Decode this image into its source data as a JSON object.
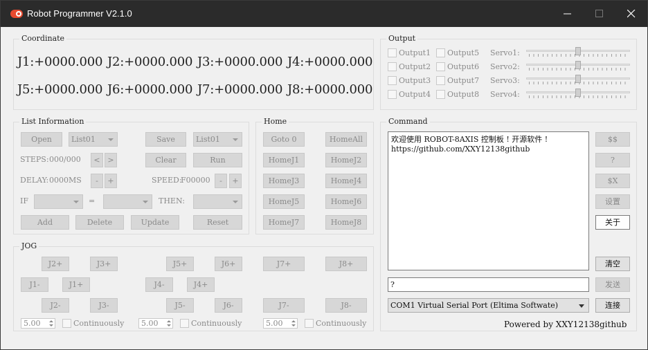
{
  "window": {
    "title": "Robot Programmer V2.1.0"
  },
  "coordinate": {
    "title": "Coordinate",
    "joints": [
      "J1:+0000.000",
      "J2:+0000.000",
      "J3:+0000.000",
      "J4:+0000.000",
      "J5:+0000.000",
      "J6:+0000.000",
      "J7:+0000.000",
      "J8:+0000.000"
    ]
  },
  "output": {
    "title": "Output",
    "checkboxes": [
      "Output1",
      "Output5",
      "Output2",
      "Output6",
      "Output3",
      "Output7",
      "Output4",
      "Output8"
    ],
    "servos": [
      {
        "label": "Servo1:",
        "level": 0.5
      },
      {
        "label": "Servo2:",
        "level": 0.5
      },
      {
        "label": "Servo3:",
        "level": 0.5
      },
      {
        "label": "Servo4:",
        "level": 0.5
      }
    ]
  },
  "list": {
    "title": "List Information",
    "open": "Open",
    "list_combo_1": "List01",
    "save": "Save",
    "list_combo_2": "List01",
    "steps_label": "STEPS:",
    "steps_value": "000/000",
    "prev": "<",
    "next": ">",
    "clear": "Clear",
    "run": "Run",
    "delay_label": "DELAY:",
    "delay_value": "0000MS",
    "minus": "-",
    "plus": "+",
    "speed_label": "SPEED:",
    "speed_value": "F00000",
    "if_label": "IF",
    "eq_label": "=",
    "then_label": "THEN:",
    "add": "Add",
    "delete": "Delete",
    "update": "Update",
    "reset": "Reset"
  },
  "home": {
    "title": "Home",
    "buttons": [
      "Goto 0",
      "HomeAll",
      "HomeJ1",
      "HomeJ2",
      "HomeJ3",
      "HomeJ4",
      "HomeJ5",
      "HomeJ6",
      "HomeJ7",
      "HomeJ8"
    ]
  },
  "command": {
    "title": "Command",
    "log": [
      "欢迎使用 ROBOT-8AXIS 控制板 ! 开源软件 !",
      "https://github.com/XXY12138github"
    ],
    "side_buttons": [
      "$$",
      "?",
      "$X",
      "设置",
      "关于"
    ],
    "clear": "清空",
    "input_value": "?",
    "send": "发送",
    "port": "COM1 Virtual Serial Port (Eltima Softwate)",
    "connect": "连接",
    "powered": "Powered by XXY12138github"
  },
  "jog": {
    "title": "JOG",
    "buttons": {
      "j2p": "J2+",
      "j3p": "J3+",
      "j5p": "J5+",
      "j6p": "J6+",
      "j7p": "J7+",
      "j8p": "J8+",
      "j1m": "J1-",
      "j1p": "J1+",
      "j4m": "J4-",
      "j4p": "J4+",
      "j2m": "J2-",
      "j3m": "J3-",
      "j5m": "J5-",
      "j6m": "J6-",
      "j7m": "J7-",
      "j8m": "J8-"
    },
    "steps": [
      {
        "value": "5.00",
        "label": "Continuously"
      },
      {
        "value": "5.00",
        "label": "Continuously"
      },
      {
        "value": "5.00",
        "label": "Continuously"
      }
    ]
  }
}
